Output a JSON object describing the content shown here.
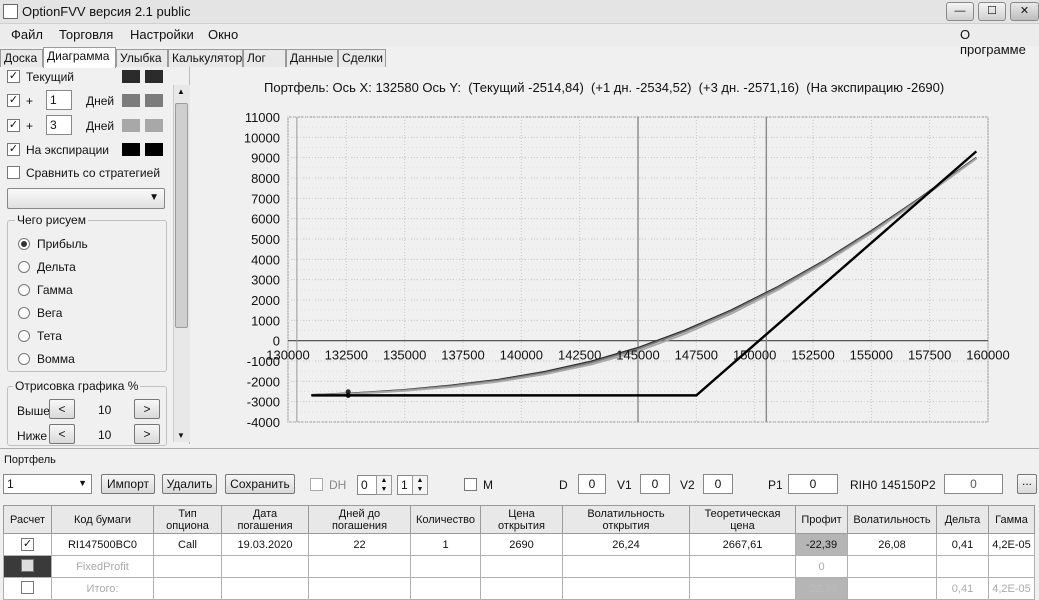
{
  "window": {
    "title": "OptionFVV версия 2.1 public",
    "min": "—",
    "max": "☐",
    "close": "✕"
  },
  "menu": {
    "file": "Файл",
    "trade": "Торговля",
    "settings": "Настройки",
    "window": "Окно",
    "about": "О программе"
  },
  "tabs": [
    "Доска",
    "Диаграмма",
    "Улыбка",
    "Калькулятор",
    "Лог",
    "Данные",
    "Сделки"
  ],
  "left": {
    "current_label": "Текущий",
    "plus": "+",
    "days1": "1",
    "days2": "3",
    "days_label": "Дней",
    "expiration_label": "На экспирации",
    "compare_label": "Сравнить со стратегией",
    "dropdown_value": "",
    "draw_group": "Чего рисуем",
    "options": [
      "Прибыль",
      "Дельта",
      "Гамма",
      "Вега",
      "Тета",
      "Вомма"
    ],
    "selected_option": "Прибыль",
    "drawing_group": "Отрисовка графика %",
    "above_label": "Выше",
    "below_label": "Ниже",
    "above_value": "10",
    "below_value": "10",
    "dec": "<",
    "inc": ">",
    "swatch_colors": [
      "#2b2b2b",
      "#7c7c7c",
      "#a8a8a8",
      "#000000"
    ]
  },
  "chart_header": "Портфель: Ось X: 132580 Ось Y:  (Текущий -2514,84)  (+1 дн. -2534,52)  (+3 дн. -2571,16)  (На экспирацию -2690)",
  "chart_data": {
    "type": "line",
    "xlim": [
      130000,
      160000
    ],
    "ylim": [
      -4000,
      11000
    ],
    "x_ticks": [
      130000,
      132500,
      135000,
      137500,
      140000,
      142500,
      145000,
      147500,
      150000,
      152500,
      155000,
      157500,
      160000
    ],
    "y_ticks": [
      11000,
      10000,
      9000,
      8000,
      7000,
      6000,
      5000,
      4000,
      3000,
      2000,
      1000,
      0,
      -1000,
      -2000,
      -3000,
      -4000
    ],
    "series": [
      {
        "color": "#2b2b2b",
        "x": [
          131000,
          133000,
          135000,
          137000,
          139000,
          141000,
          143000,
          145000,
          147000,
          149000,
          151000,
          153000,
          155000,
          157000,
          159500
        ],
        "y": [
          -2670,
          -2570,
          -2420,
          -2200,
          -1920,
          -1530,
          -1020,
          -350,
          500,
          1500,
          2650,
          3950,
          5400,
          6950,
          9000
        ]
      },
      {
        "color": "#7c7c7c",
        "x": [
          131000,
          133000,
          135000,
          137000,
          139000,
          141000,
          143000,
          145000,
          147000,
          149000,
          151000,
          153000,
          155000,
          157000,
          159500
        ],
        "y": [
          -2675,
          -2580,
          -2440,
          -2230,
          -1960,
          -1580,
          -1080,
          -410,
          440,
          1440,
          2600,
          3900,
          5350,
          6920,
          8980
        ]
      },
      {
        "color": "#a8a8a8",
        "x": [
          131000,
          133000,
          135000,
          137000,
          139000,
          141000,
          143000,
          145000,
          147000,
          149000,
          151000,
          153000,
          155000,
          157000,
          159500
        ],
        "y": [
          -2680,
          -2600,
          -2470,
          -2280,
          -2020,
          -1650,
          -1170,
          -520,
          330,
          1330,
          2500,
          3820,
          5280,
          6870,
          8950
        ]
      },
      {
        "color": "#000000",
        "x": [
          131000,
          147500,
          159500
        ],
        "y": [
          -2690,
          -2690,
          9310
        ]
      }
    ],
    "vlines": [
      145000,
      150500
    ],
    "cursor_x": 132580,
    "grid": true
  },
  "portfolio": {
    "group_label": "Портфель",
    "select_value": "1",
    "import": "Импорт",
    "delete": "Удалить",
    "save": "Сохранить",
    "dh": "DH",
    "spin1": "0",
    "spin2": "1",
    "m": "M",
    "d_label": "D",
    "d_value": "0",
    "v1_label": "V1",
    "v1_value": "0",
    "v2_label": "V2",
    "v2_value": "0",
    "p1_label": "P1",
    "p1_value": "0",
    "rih": "RIH0 145150",
    "p2_label": "P2",
    "p2_value": "0",
    "ellipsis": "..."
  },
  "table": {
    "headers": [
      "Расчет",
      "Код бумаги",
      "Тип\nопциона",
      "Дата\nпогашения",
      "Дней до\nпогашения",
      "Количество",
      "Цена\nоткрытия",
      "Волатильность\nоткрытия",
      "Теоретическая\nцена",
      "Профит",
      "Волатильность",
      "Дельта",
      "Гамма"
    ],
    "row1": [
      "RI147500BC0",
      "Call",
      "19.03.2020",
      "22",
      "1",
      "2690",
      "26,24",
      "2667,61",
      "-22,39",
      "26,08",
      "0,41",
      "4,2E-05"
    ],
    "row2_code": "FixedProfit",
    "row2_profit": "0",
    "row3_code": "Итого:",
    "row3_profit": "-22,39",
    "row3_delta": "0,41",
    "row3_gamma": "4,2E-05"
  }
}
